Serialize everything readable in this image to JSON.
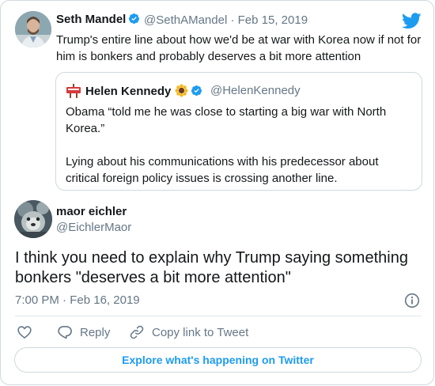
{
  "colors": {
    "accent": "#1d9bf0",
    "text_primary": "#14171a",
    "text_secondary": "#657786",
    "border": "#cfd9de"
  },
  "parent_tweet": {
    "author_name": "Seth Mandel",
    "handle": "@SethAMandel",
    "separator": "·",
    "date": "Feb 15, 2019",
    "text": "Trump's entire line about how we'd be at war with Korea now if not for him is bonkers and probably deserves a bit more attention",
    "quoted_tweet": {
      "author_name": "Helen Kennedy",
      "handle": "@HelenKennedy",
      "paragraph_1": "Obama “told me he was close to starting a big war with North Korea.”",
      "paragraph_2": "Lying about his communications with his predecessor about critical foreign policy issues is crossing another line."
    }
  },
  "main_tweet": {
    "author_name": "maor eichler",
    "handle": "@EichlerMaor",
    "text": "I think you need to explain why Trump saying something bonkers \"deserves a bit more attention\"",
    "time": "7:00 PM",
    "separator": "·",
    "date": "Feb 16, 2019"
  },
  "actions": {
    "like_icon": "heart-icon",
    "reply_label": "Reply",
    "copy_link_label": "Copy link to Tweet"
  },
  "explore_label": "Explore what's happening on Twitter"
}
